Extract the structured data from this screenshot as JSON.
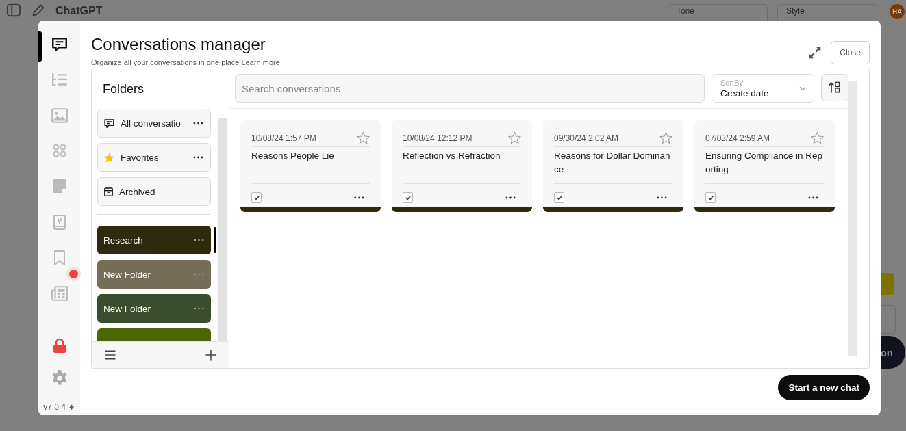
{
  "background": {
    "app_title": "ChatGPT",
    "dropdowns": [
      {
        "label": "Tone"
      },
      {
        "label": "Style"
      }
    ],
    "avatar": "HA",
    "partial_button": "on"
  },
  "modal": {
    "title": "Conversations manager",
    "subtitle": "Organize all your conversations in one place",
    "link": "Learn more",
    "close": "Close",
    "start_button": "Start a new chat",
    "version": "v7.0.4"
  },
  "rail": [
    {
      "kind": "chat",
      "selected": true,
      "alert": false
    },
    {
      "kind": "tree",
      "selected": false,
      "alert": false
    },
    {
      "kind": "image",
      "selected": false,
      "alert": false
    },
    {
      "kind": "apps",
      "selected": false,
      "alert": false
    },
    {
      "kind": "note",
      "selected": false,
      "alert": false
    },
    {
      "kind": "book",
      "selected": false,
      "alert": false
    },
    {
      "kind": "bookmark",
      "selected": false,
      "alert": false
    },
    {
      "kind": "news",
      "selected": false,
      "alert": true
    }
  ],
  "folders": {
    "title": "Folders",
    "fixed": [
      {
        "kind": "all",
        "label": "All conversatio",
        "menu": true
      },
      {
        "kind": "favorites",
        "label": "Favorites",
        "menu": true
      },
      {
        "kind": "archived",
        "label": "Archived",
        "menu": false
      }
    ],
    "items": [
      {
        "name": "Research",
        "color": "#2f2a0c",
        "selected": true
      },
      {
        "name": "New Folder",
        "color": "#756d59",
        "selected": false
      },
      {
        "name": "New Folder",
        "color": "#3a4d2e",
        "selected": false
      },
      {
        "color": "#4b6604",
        "selected": false
      }
    ]
  },
  "search": {
    "placeholder": "Search conversations"
  },
  "sort": {
    "label": "SortBy",
    "value": "Create date"
  },
  "conversations": [
    {
      "date": "10/08/24 1:57 PM",
      "title": "Reasons People Lie",
      "starred": false,
      "checked": true,
      "color": "#2f2a0c"
    },
    {
      "date": "10/08/24 12:12 PM",
      "title": "Reflection vs Refraction",
      "starred": false,
      "checked": true,
      "color": "#2f2a0c"
    },
    {
      "date": "09/30/24 2:02 AM",
      "title": "Reasons for Dollar Dominance",
      "starred": false,
      "checked": true,
      "color": "#2f2a0c"
    },
    {
      "date": "07/03/24 2:59 AM",
      "title": "Ensuring Compliance in Reporting",
      "starred": false,
      "checked": true,
      "color": "#2f2a0c"
    }
  ]
}
